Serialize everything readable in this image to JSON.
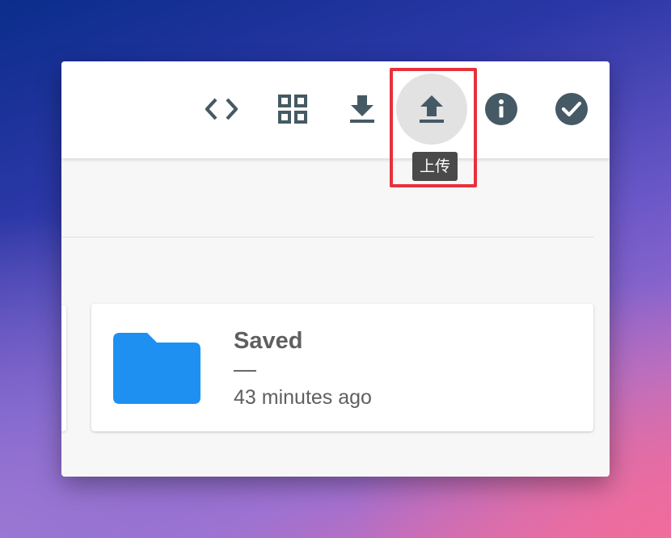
{
  "toolbar": {
    "buttons": [
      {
        "name": "code",
        "icon": "code-icon"
      },
      {
        "name": "grid",
        "icon": "grid-view-icon"
      },
      {
        "name": "download",
        "icon": "download-icon"
      },
      {
        "name": "upload",
        "icon": "upload-icon"
      },
      {
        "name": "info",
        "icon": "info-icon"
      },
      {
        "name": "select",
        "icon": "check-circle-icon"
      }
    ],
    "tooltip": "上传",
    "icon_color": "#455a64",
    "highlight_color": "#e8303d"
  },
  "card": {
    "title": "Saved",
    "subtitle": "—",
    "time": "43 minutes ago",
    "folder_color": "#1e90f2"
  }
}
